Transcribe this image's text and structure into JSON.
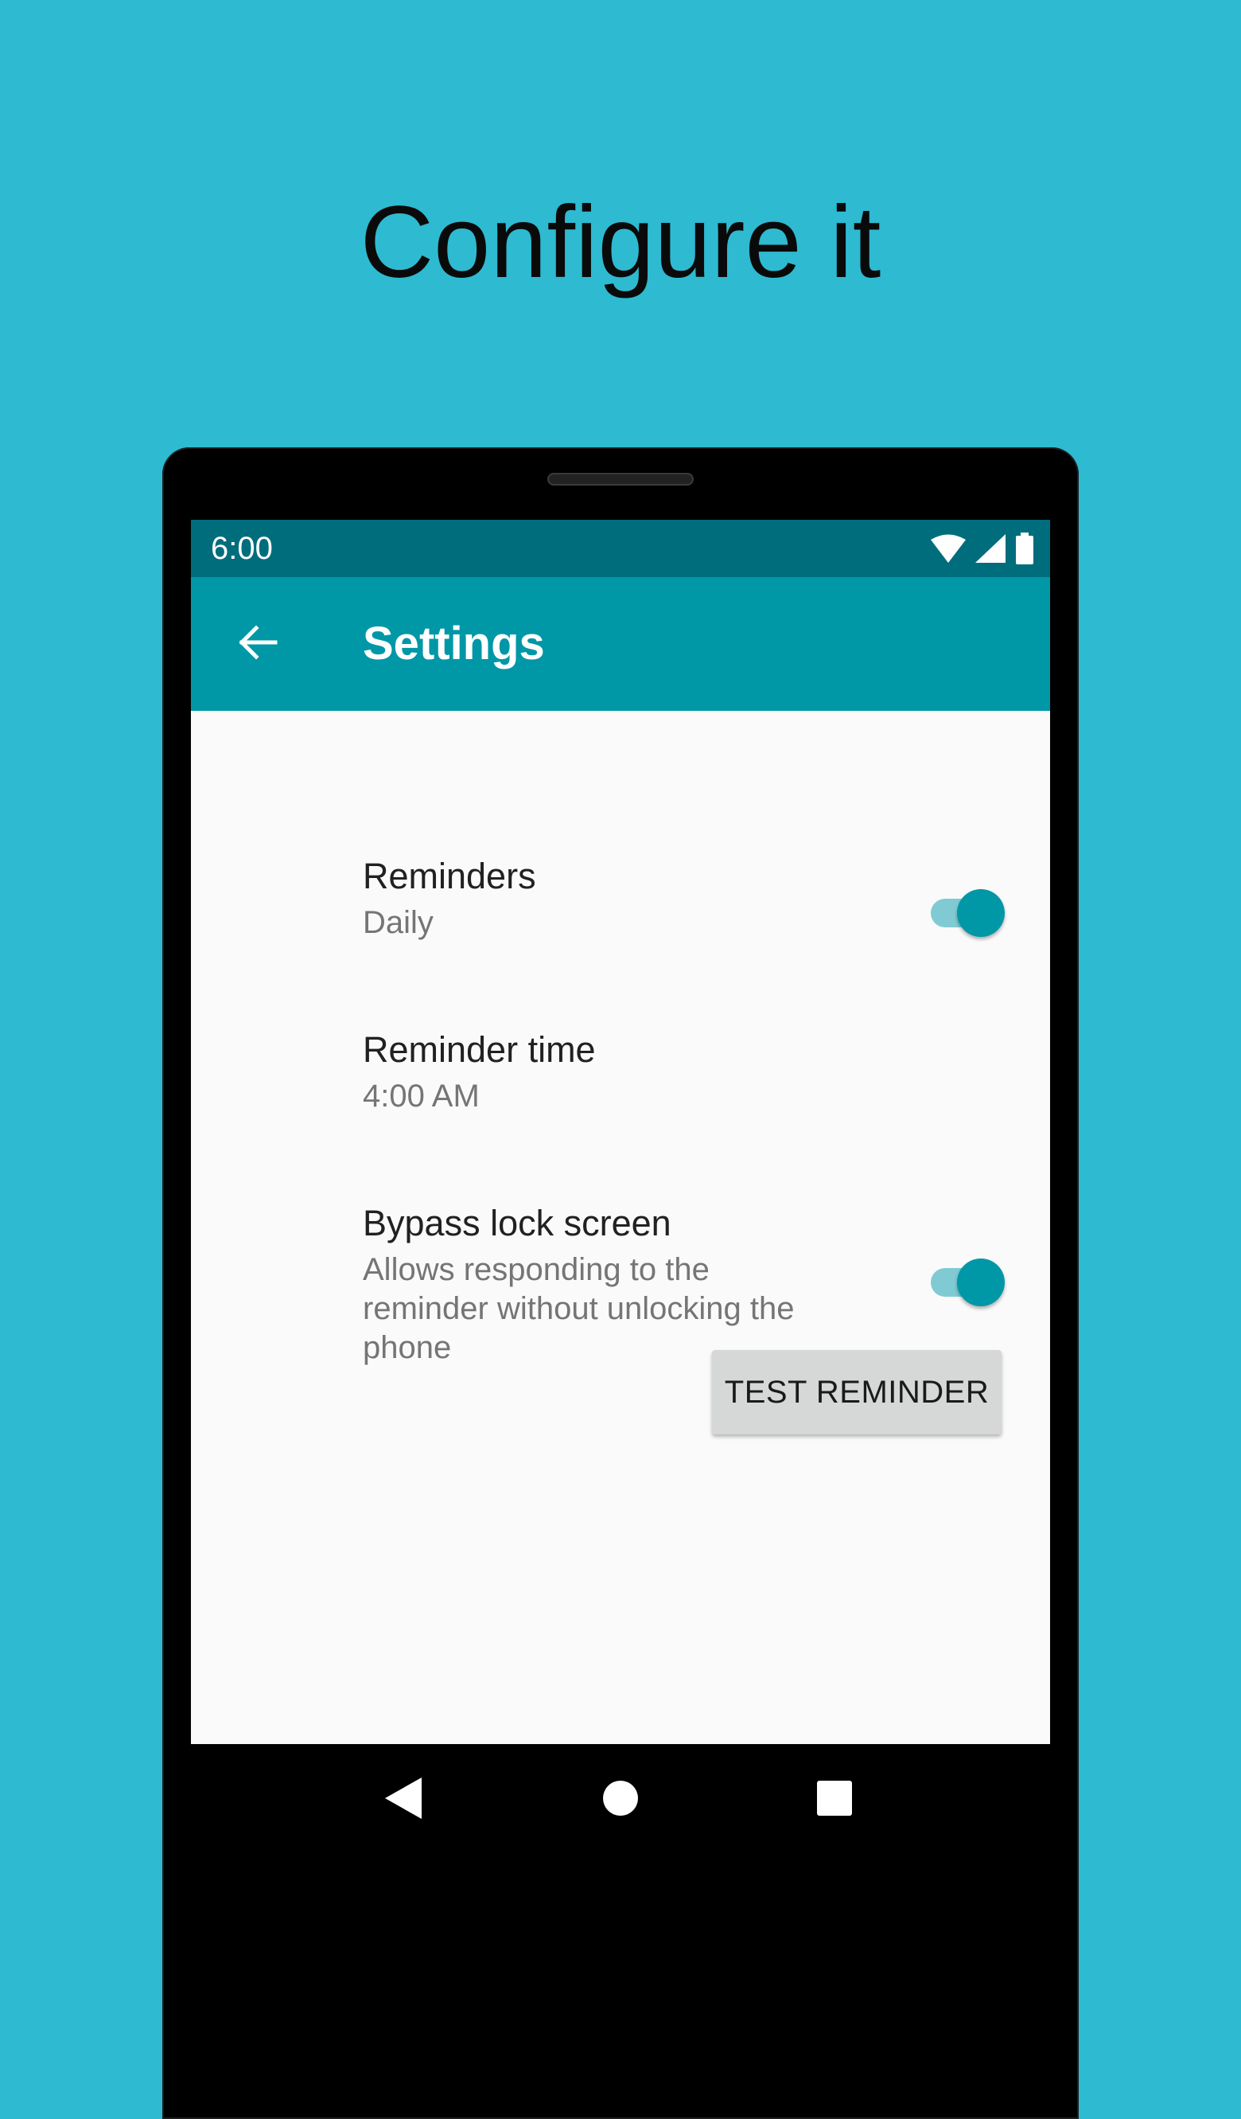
{
  "headline": "Configure it",
  "status_bar": {
    "time": "6:00",
    "icons": [
      "wifi-icon",
      "cell-signal-icon",
      "battery-icon"
    ]
  },
  "app_bar": {
    "back_icon": "arrow-back-icon",
    "title": "Settings"
  },
  "preferences": [
    {
      "title": "Reminders",
      "summary": "Daily",
      "switch_on": true
    },
    {
      "title": "Reminder time",
      "summary": "4:00 AM"
    },
    {
      "title": "Bypass lock screen",
      "summary": "Allows responding to the reminder without unlocking the phone",
      "switch_on": true
    }
  ],
  "test_button": {
    "label": "TEST REMINDER"
  },
  "nav_bar": {
    "icons": [
      "nav-back-icon",
      "nav-home-icon",
      "nav-recents-icon"
    ]
  },
  "colors": {
    "background": "#2EBAD1",
    "status_bar": "#006D7D",
    "app_bar": "#0097A7",
    "accent": "#0097A7",
    "switch_track_on": "#80CBD3",
    "screen": "#FAFAFA",
    "button": "#D6D7D7"
  }
}
